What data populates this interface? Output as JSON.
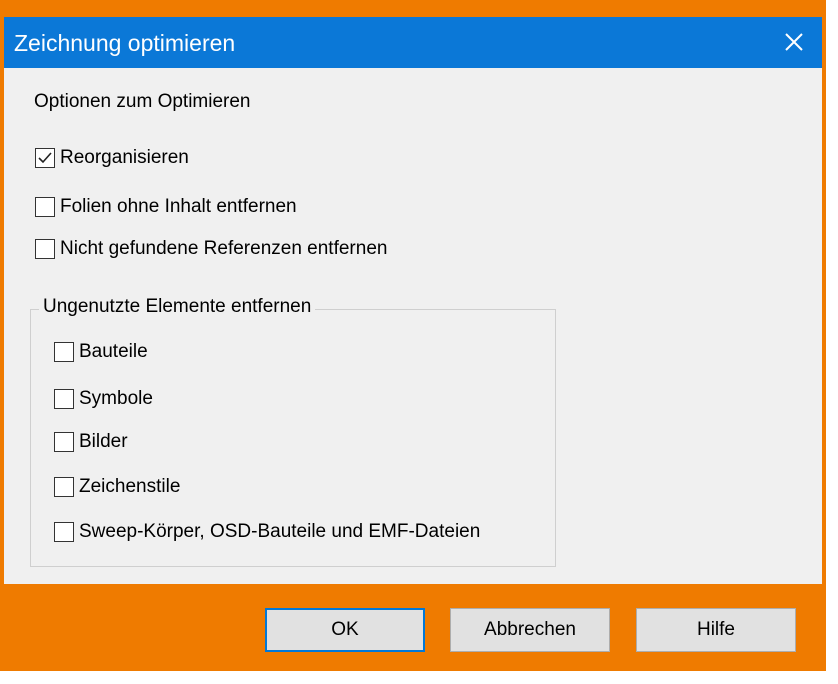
{
  "dialog": {
    "title": "Zeichnung optimieren",
    "close_label": "✕"
  },
  "options": {
    "heading": "Optionen zum Optimieren",
    "items": [
      {
        "label": "Reorganisieren",
        "checked": true
      },
      {
        "label": "Folien ohne Inhalt entfernen",
        "checked": false
      },
      {
        "label": "Nicht gefundene Referenzen entfernen",
        "checked": false
      }
    ]
  },
  "unused_group": {
    "label": "Ungenutzte Elemente entfernen",
    "items": [
      {
        "label": "Bauteile",
        "checked": false
      },
      {
        "label": "Symbole",
        "checked": false
      },
      {
        "label": "Bilder",
        "checked": false
      },
      {
        "label": "Zeichenstile",
        "checked": false
      },
      {
        "label": "Sweep-Körper, OSD-Bauteile und EMF-Dateien",
        "checked": false
      }
    ]
  },
  "buttons": {
    "ok": "OK",
    "cancel": "Abbrechen",
    "help": "Hilfe"
  },
  "colors": {
    "titlebar": "#0b78d7",
    "frame": "#ef7b00",
    "client": "#f0f0f0"
  }
}
